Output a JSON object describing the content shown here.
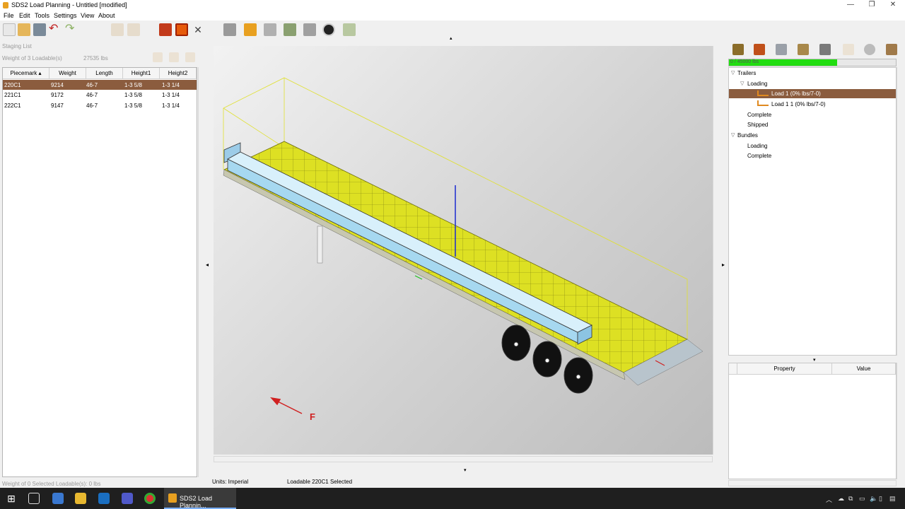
{
  "window": {
    "title": "SDS2 Load Planning - Untitled [modified]"
  },
  "menu": [
    "File",
    "Edit",
    "Tools",
    "Settings",
    "View",
    "About"
  ],
  "staging": {
    "section_title": "Staging List",
    "weight_label": "Weight of 3 Loadable(s)",
    "weight_value": "27535 lbs",
    "columns": [
      "Piecemark",
      "Weight",
      "Length",
      "Height1",
      "Height2"
    ],
    "rows": [
      {
        "piecemark": "220C1",
        "weight": "9214",
        "length": "46-7",
        "height1": "1-3 5/8",
        "height2": "1-3 1/4",
        "selected": true
      },
      {
        "piecemark": "221C1",
        "weight": "9172",
        "length": "46-7",
        "height1": "1-3 5/8",
        "height2": "1-3 1/4",
        "selected": false
      },
      {
        "piecemark": "222C1",
        "weight": "9147",
        "length": "46-7",
        "height1": "1-3 5/8",
        "height2": "1-3 1/4",
        "selected": false
      }
    ],
    "selected_weight": "Weight of 0 Selected Loadable(s): 0 lbs"
  },
  "viewport": {
    "direction_label": "F"
  },
  "status": {
    "units": "Units: Imperial",
    "selection": "Loadable 220C1 Selected"
  },
  "capacity": {
    "label": "0 / 45000 lbs",
    "fill_fraction": 0.65
  },
  "tree": {
    "trailers": "Trailers",
    "loading": "Loading",
    "load1": "Load 1 (0% lbs/7-0)",
    "load11": "Load 1 1 (0% lbs/7-0)",
    "complete": "Complete",
    "shipped": "Shipped",
    "bundles": "Bundles",
    "bundles_loading": "Loading",
    "bundles_complete": "Complete"
  },
  "properties": {
    "col_property": "Property",
    "col_value": "Value"
  },
  "taskbar": {
    "active_app": "SDS2 Load Plannin..."
  },
  "colors": {
    "selection": "#8b5c3e",
    "progress": "#22dd11",
    "deck": "#d8e020"
  }
}
